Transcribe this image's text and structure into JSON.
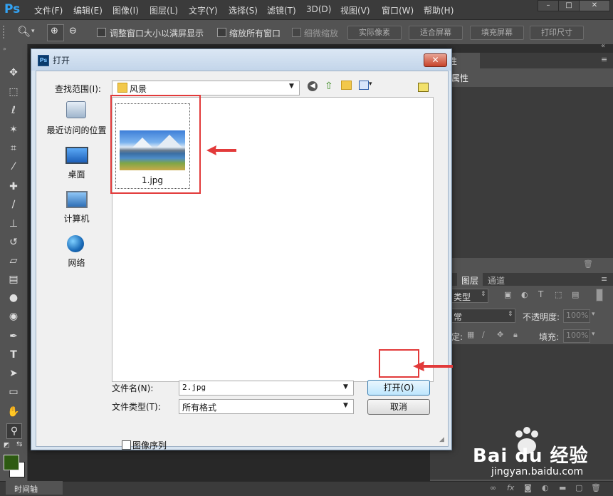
{
  "app": {
    "logo": "Ps",
    "menu": [
      "文件(F)",
      "编辑(E)",
      "图像(I)",
      "图层(L)",
      "文字(Y)",
      "选择(S)",
      "滤镜(T)",
      "3D(D)",
      "视图(V)",
      "窗口(W)",
      "帮助(H)"
    ],
    "window_controls": [
      "–",
      "□",
      "✕"
    ]
  },
  "options": {
    "resize_windows": "调整窗口大小以满屏显示",
    "zoom_all": "缩放所有窗口",
    "scrubby_zoom": "细微缩放",
    "actual_pixels": "实际像素",
    "fit_screen": "适合屏幕",
    "fill_screen": "填充屏幕",
    "print_size": "打印尺寸"
  },
  "panels": {
    "properties_tab": "性",
    "properties_title": "属性",
    "layers_tab": "图层",
    "channels_tab": "通道",
    "kind_label": "类型",
    "blend_mode": "常",
    "opacity_label": "不透明度:",
    "opacity_value": "100%",
    "lock_label": "定:",
    "fill_label": "填充:",
    "fill_value": "100%"
  },
  "timeline_tab": "时间轴",
  "dialog": {
    "title": "打开",
    "close": "✕",
    "look_in_label": "查找范围(I):",
    "look_in_value": "风景",
    "places": [
      "最近访问的位置",
      "桌面",
      "计算机",
      "网络"
    ],
    "files": [
      {
        "name": "1.jpg"
      }
    ],
    "filename_label": "文件名(N):",
    "filename_value": "2.jpg",
    "filetype_label": "文件类型(T):",
    "filetype_value": "所有格式",
    "open_button": "打开(O)",
    "cancel_button": "取消",
    "image_sequence": "图像序列"
  },
  "watermark": {
    "brand": "Bai du 经验",
    "url": "jingyan.baidu.com"
  },
  "colors": {
    "annotation_red": "#e23a3a",
    "foreground": "#2d5a12",
    "background": "#ffffff"
  }
}
